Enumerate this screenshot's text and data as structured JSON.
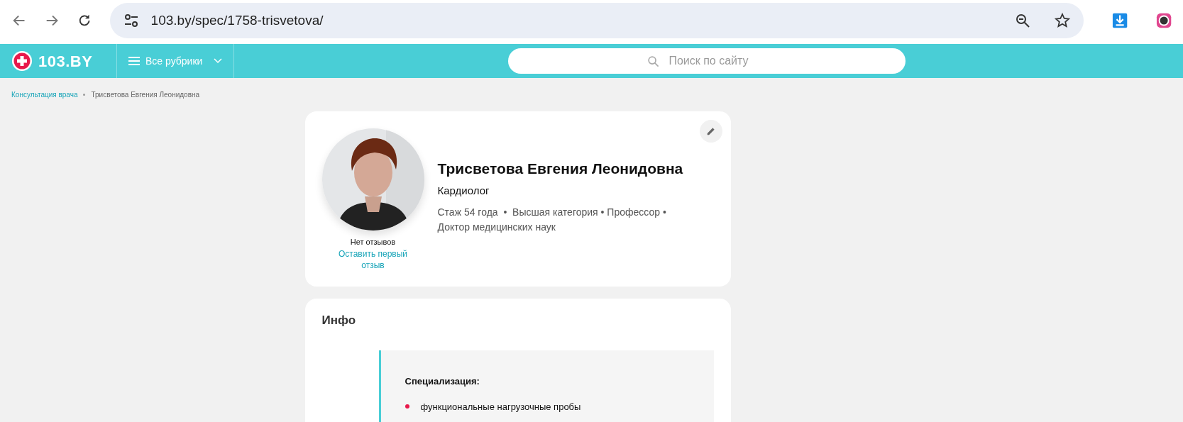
{
  "browser": {
    "url": "103.by/spec/1758-trisvetova/"
  },
  "header": {
    "logo_text": "103.BY",
    "menu_label": "Все рубрики",
    "search_placeholder": "Поиск по сайту"
  },
  "breadcrumbs": [
    {
      "label": "Консультация врача",
      "kind": "link"
    },
    {
      "label": "Трисветова Евгения Леонидовна",
      "kind": "current"
    }
  ],
  "profile": {
    "name": "Трисветова Евгения Леонидовна",
    "specialty": "Кардиолог",
    "details": "Стаж 54 года  •  Высшая категория • Профессор • Доктор медицинских наук",
    "reviews_status": "Нет отзывов",
    "review_link": "Оставить первый отзыв"
  },
  "info": {
    "title": "Инфо",
    "heading": "Специализация:",
    "items": [
      "функциональные нагрузочные пробы"
    ]
  }
}
